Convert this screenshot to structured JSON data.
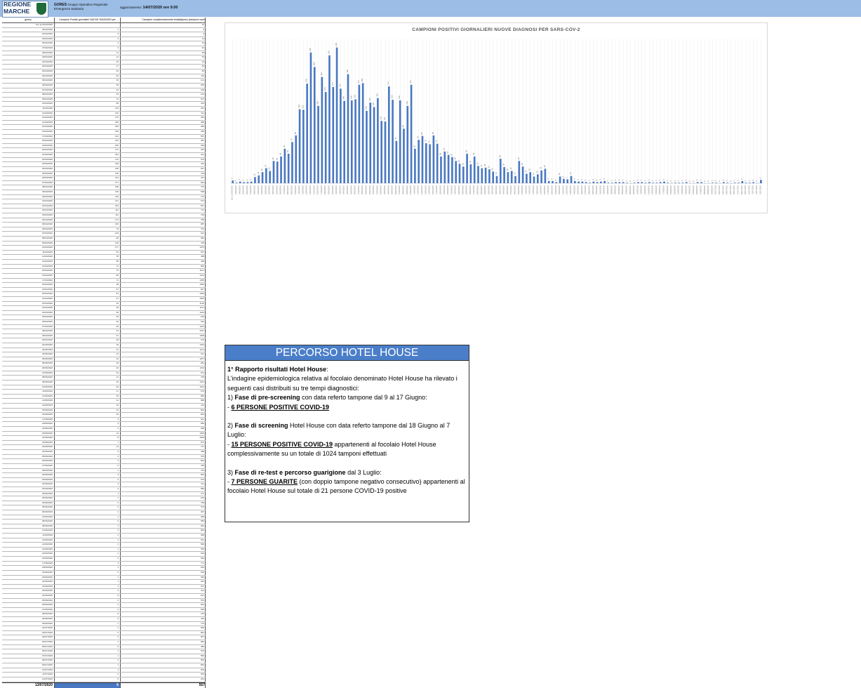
{
  "header": {
    "logo_text": [
      "REGIONE",
      "MARCHE"
    ],
    "org_name": "GORES",
    "org_line1": "Gruppo Operativo Regionale",
    "org_line2": "Emergenza Sanitaria",
    "update_prefix": "aggiornamento:",
    "update_value": "14/07/2020 ore 9.00"
  },
  "table": {
    "columns": [
      "giorno",
      "Campioni Positivi giornalieri NUOVE DIAGNOSI per",
      "Campioni complessivamente testati/giorno (tamponi nuovi"
    ],
    "first_row": [
      "fino al 22/02/2020",
      "",
      "24"
    ],
    "rows": [
      [
        "23/02/2020",
        "1",
        "5"
      ],
      [
        "24/02/2020",
        "3",
        "6"
      ],
      [
        "25/02/2020",
        "2",
        "24"
      ],
      [
        "26/02/2020",
        "2",
        "23"
      ],
      [
        "27/02/2020",
        "3",
        "32"
      ],
      [
        "28/02/2020",
        "11",
        "38"
      ],
      [
        "29/02/2020",
        "14",
        "36"
      ],
      [
        "01/03/2020",
        "20",
        "44"
      ],
      [
        "02/03/2020",
        "27",
        "83"
      ],
      [
        "03/03/2020",
        "22",
        "85"
      ],
      [
        "04/03/2020",
        "40",
        "115"
      ],
      [
        "05/03/2020",
        "39",
        "121"
      ],
      [
        "06/03/2020",
        "48",
        "205"
      ],
      [
        "07/03/2020",
        "62",
        "218"
      ],
      [
        "08/03/2020",
        "53",
        "214"
      ],
      [
        "09/03/2020",
        "74",
        "207"
      ],
      [
        "10/03/2020",
        "86",
        "316"
      ],
      [
        "11/03/2020",
        "133",
        "251"
      ],
      [
        "12/03/2020",
        "132",
        "311"
      ],
      [
        "13/03/2020",
        "179",
        "362"
      ],
      [
        "14/03/2020",
        "235",
        "380"
      ],
      [
        "15/03/2020",
        "209",
        "360"
      ],
      [
        "16/03/2020",
        "139",
        "335"
      ],
      [
        "17/03/2020",
        "191",
        "557"
      ],
      [
        "18/03/2020",
        "164",
        "451"
      ],
      [
        "19/03/2020",
        "230",
        "493"
      ],
      [
        "20/03/2020",
        "173",
        "515"
      ],
      [
        "21/03/2020",
        "244",
        "611"
      ],
      [
        "22/03/2020",
        "170",
        "575"
      ],
      [
        "23/03/2020",
        "148",
        "443"
      ],
      [
        "24/03/2020",
        "196",
        "647"
      ],
      [
        "25/03/2020",
        "149",
        "733"
      ],
      [
        "26/03/2020",
        "151",
        "437"
      ],
      [
        "27/03/2020",
        "177",
        "824"
      ],
      [
        "28/03/2020",
        "180",
        "767"
      ],
      [
        "29/03/2020",
        "130",
        "548"
      ],
      [
        "30/03/2020",
        "145",
        "741"
      ],
      [
        "31/03/2020",
        "137",
        "572"
      ],
      [
        "01/04/2020",
        "153",
        "847"
      ],
      [
        "02/04/2020",
        "112",
        "707"
      ],
      [
        "03/04/2020",
        "111",
        "794"
      ],
      [
        "04/04/2020",
        "174",
        "785"
      ],
      [
        "05/04/2020",
        "150",
        "887"
      ],
      [
        "06/04/2020",
        "76",
        "702"
      ],
      [
        "07/04/2020",
        "149",
        "913"
      ],
      [
        "08/04/2020",
        "98",
        "952"
      ],
      [
        "09/04/2020",
        "139",
        "795"
      ],
      [
        "10/04/2020",
        "177",
        "1070"
      ],
      [
        "11/04/2020",
        "62",
        "997"
      ],
      [
        "12/04/2020",
        "78",
        "458"
      ],
      [
        "13/04/2020",
        "85",
        "499"
      ],
      [
        "14/04/2020",
        "72",
        "862"
      ],
      [
        "15/04/2020",
        "70",
        "1107"
      ],
      [
        "16/04/2020",
        "86",
        "1214"
      ],
      [
        "17/04/2020",
        "71",
        "1365"
      ],
      [
        "18/04/2020",
        "48",
        "1090"
      ],
      [
        "19/04/2020",
        "57",
        "967"
      ],
      [
        "20/04/2020",
        "51",
        "1006"
      ],
      [
        "21/04/2020",
        "47",
        "1053"
      ],
      [
        "22/04/2020",
        "40",
        "1130"
      ],
      [
        "23/04/2020",
        "35",
        "1141"
      ],
      [
        "24/04/2020",
        "30",
        "1145"
      ],
      [
        "25/04/2020",
        "53",
        "916"
      ],
      [
        "26/04/2020",
        "34",
        "510"
      ],
      [
        "27/04/2020",
        "48",
        "1044"
      ],
      [
        "28/04/2020",
        "31",
        "1237"
      ],
      [
        "29/04/2020",
        "27",
        "1008"
      ],
      [
        "30/04/2020",
        "28",
        "976"
      ],
      [
        "01/05/2020",
        "25",
        "1016"
      ],
      [
        "02/05/2020",
        "21",
        "1121"
      ],
      [
        "03/05/2020",
        "13",
        "917"
      ],
      [
        "04/05/2020",
        "44",
        "1207"
      ],
      [
        "05/05/2020",
        "29",
        "981"
      ],
      [
        "06/05/2020",
        "20",
        "1232"
      ],
      [
        "07/05/2020",
        "22",
        "811"
      ],
      [
        "08/05/2020",
        "13",
        "735"
      ],
      [
        "09/05/2020",
        "40",
        "1337"
      ],
      [
        "10/05/2020",
        "30",
        "1012"
      ],
      [
        "11/05/2020",
        "17",
        "672"
      ],
      [
        "12/05/2020",
        "20",
        "865"
      ],
      [
        "13/05/2020",
        "12",
        "989"
      ],
      [
        "14/05/2020",
        "16",
        "743"
      ],
      [
        "15/05/2020",
        "23",
        "861"
      ],
      [
        "16/05/2020",
        "26",
        "863"
      ],
      [
        "17/05/2020",
        "4",
        "621"
      ],
      [
        "18/05/2020",
        "4",
        "680"
      ],
      [
        "19/05/2020",
        "2",
        "838"
      ],
      [
        "20/05/2020",
        "12",
        "1005"
      ],
      [
        "21/05/2020",
        "8",
        "1006"
      ],
      [
        "22/05/2020",
        "7",
        "871"
      ],
      [
        "23/05/2020",
        "13",
        "717"
      ],
      [
        "24/05/2020",
        "4",
        "398"
      ],
      [
        "25/05/2020",
        "3",
        "576"
      ],
      [
        "26/05/2020",
        "3",
        "802"
      ],
      [
        "27/05/2020",
        "2",
        "786"
      ],
      [
        "28/05/2020",
        "1",
        "702"
      ],
      [
        "29/05/2020",
        "3",
        "584"
      ],
      [
        "30/05/2020",
        "2",
        "670"
      ],
      [
        "31/05/2020",
        "3",
        "211"
      ],
      [
        "01/06/2020",
        "4",
        "586"
      ],
      [
        "02/06/2020",
        "1",
        "371"
      ],
      [
        "03/06/2020",
        "1",
        "623"
      ],
      [
        "04/06/2020",
        "2",
        "768"
      ],
      [
        "05/06/2020",
        "2",
        "579"
      ],
      [
        "06/06/2020",
        "2",
        "397"
      ],
      [
        "07/06/2020",
        "1",
        "360"
      ],
      [
        "08/06/2020",
        "0",
        "589"
      ],
      [
        "09/06/2020",
        "1",
        "902"
      ],
      [
        "10/06/2020",
        "2",
        "894"
      ],
      [
        "11/06/2020",
        "2",
        "638"
      ],
      [
        "12/06/2020",
        "1",
        "561"
      ],
      [
        "13/06/2020",
        "2",
        "582"
      ],
      [
        "14/06/2020",
        "1",
        "356"
      ],
      [
        "15/06/2020",
        "1",
        "640"
      ],
      [
        "16/06/2020",
        "2",
        "693"
      ],
      [
        "17/06/2020",
        "3",
        "771"
      ],
      [
        "18/06/2020",
        "1",
        "624"
      ],
      [
        "19/06/2020",
        "0",
        "549"
      ],
      [
        "20/06/2020",
        "1",
        "666"
      ],
      [
        "21/06/2020",
        "1",
        "324"
      ],
      [
        "22/06/2020",
        "1",
        "517"
      ],
      [
        "23/06/2020",
        "2",
        "611"
      ],
      [
        "24/06/2020",
        "0",
        "547"
      ],
      [
        "25/06/2020",
        "0",
        "574"
      ],
      [
        "26/06/2020",
        "2",
        "623"
      ],
      [
        "27/06/2020",
        "2",
        "696"
      ],
      [
        "28/06/2020",
        "0",
        "276"
      ],
      [
        "29/06/2020",
        "0",
        "424"
      ],
      [
        "30/06/2020",
        "1",
        "776"
      ],
      [
        "01/07/2020",
        "1",
        "846"
      ],
      [
        "02/07/2020",
        "0",
        "881"
      ],
      [
        "03/07/2020",
        "2",
        "857"
      ],
      [
        "04/07/2020",
        "1",
        "862"
      ],
      [
        "05/07/2020",
        "0",
        "385"
      ],
      [
        "06/07/2020",
        "1",
        "544"
      ],
      [
        "07/07/2020",
        "1",
        "596"
      ],
      [
        "08/07/2020",
        "4",
        "800"
      ],
      [
        "09/07/2020",
        "1",
        "854"
      ],
      [
        "10/07/2020",
        "1",
        "605"
      ],
      [
        "11/07/2020",
        "2",
        "630"
      ],
      [
        "12/07/2020",
        "0",
        "202"
      ]
    ],
    "total": [
      "13/07/2020",
      "6",
      "557"
    ]
  },
  "chart_data": {
    "type": "bar",
    "title": "CAMPIONI POSITIVI GIORNALIERI NUOVE DIAGNOSI PER SARS-COV-2",
    "categories": [
      "fino al 22/02/2020",
      "23/02/2020",
      "24/02/2020",
      "25/02/2020",
      "26/02/2020",
      "27/02/2020",
      "28/02/2020",
      "29/02/2020",
      "01/03/2020",
      "02/03/2020",
      "03/03/2020",
      "04/03/2020",
      "05/03/2020",
      "06/03/2020",
      "07/03/2020",
      "08/03/2020",
      "09/03/2020",
      "10/03/2020",
      "11/03/2020",
      "12/03/2020",
      "13/03/2020",
      "14/03/2020",
      "15/03/2020",
      "16/03/2020",
      "17/03/2020",
      "18/03/2020",
      "19/03/2020",
      "20/03/2020",
      "21/03/2020",
      "22/03/2020",
      "23/03/2020",
      "24/03/2020",
      "25/03/2020",
      "26/03/2020",
      "27/03/2020",
      "28/03/2020",
      "29/03/2020",
      "30/03/2020",
      "31/03/2020",
      "01/04/2020",
      "02/04/2020",
      "03/04/2020",
      "04/04/2020",
      "05/04/2020",
      "06/04/2020",
      "07/04/2020",
      "08/04/2020",
      "09/04/2020",
      "10/04/2020",
      "11/04/2020",
      "12/04/2020",
      "13/04/2020",
      "14/04/2020",
      "15/04/2020",
      "16/04/2020",
      "17/04/2020",
      "18/04/2020",
      "19/04/2020",
      "20/04/2020",
      "21/04/2020",
      "22/04/2020",
      "23/04/2020",
      "24/04/2020",
      "25/04/2020",
      "26/04/2020",
      "27/04/2020",
      "28/04/2020",
      "29/04/2020",
      "30/04/2020",
      "01/05/2020",
      "02/05/2020",
      "03/05/2020",
      "04/05/2020",
      "05/05/2020",
      "06/05/2020",
      "07/05/2020",
      "08/05/2020",
      "09/05/2020",
      "10/05/2020",
      "11/05/2020",
      "12/05/2020",
      "13/05/2020",
      "14/05/2020",
      "15/05/2020",
      "16/05/2020",
      "17/05/2020",
      "18/05/2020",
      "19/05/2020",
      "20/05/2020",
      "21/05/2020",
      "22/05/2020",
      "23/05/2020",
      "24/05/2020",
      "25/05/2020",
      "26/05/2020",
      "27/05/2020",
      "28/05/2020",
      "29/05/2020",
      "30/05/2020",
      "31/05/2020",
      "01/06/2020",
      "02/06/2020",
      "03/06/2020",
      "04/06/2020",
      "05/06/2020",
      "06/06/2020",
      "07/06/2020",
      "08/06/2020",
      "09/06/2020",
      "10/06/2020",
      "11/06/2020",
      "12/06/2020",
      "13/06/2020",
      "14/06/2020",
      "15/06/2020",
      "16/06/2020",
      "17/06/2020",
      "18/06/2020",
      "19/06/2020",
      "20/06/2020",
      "21/06/2020",
      "22/06/2020",
      "23/06/2020",
      "24/06/2020",
      "25/06/2020",
      "26/06/2020",
      "27/06/2020",
      "28/06/2020",
      "29/06/2020",
      "30/06/2020",
      "01/07/2020",
      "02/07/2020",
      "03/07/2020",
      "04/07/2020",
      "05/07/2020",
      "06/07/2020",
      "07/07/2020",
      "08/07/2020",
      "09/07/2020",
      "10/07/2020",
      "11/07/2020",
      "12/07/2020",
      "13/07/2020"
    ],
    "values": [
      5,
      1,
      3,
      2,
      2,
      3,
      11,
      14,
      20,
      27,
      22,
      40,
      39,
      48,
      62,
      53,
      74,
      86,
      133,
      132,
      179,
      235,
      209,
      139,
      191,
      164,
      230,
      173,
      244,
      170,
      148,
      196,
      149,
      151,
      177,
      180,
      130,
      145,
      137,
      153,
      112,
      111,
      174,
      150,
      76,
      149,
      98,
      139,
      177,
      62,
      78,
      85,
      72,
      70,
      86,
      71,
      48,
      57,
      51,
      47,
      40,
      35,
      30,
      53,
      34,
      48,
      31,
      27,
      28,
      25,
      21,
      13,
      44,
      29,
      20,
      22,
      13,
      40,
      30,
      17,
      20,
      12,
      16,
      23,
      26,
      4,
      4,
      2,
      12,
      8,
      7,
      13,
      4,
      3,
      3,
      2,
      1,
      3,
      2,
      3,
      4,
      1,
      1,
      2,
      2,
      2,
      1,
      0,
      1,
      2,
      2,
      1,
      2,
      1,
      1,
      2,
      3,
      1,
      0,
      1,
      1,
      1,
      2,
      0,
      0,
      2,
      2,
      0,
      0,
      1,
      1,
      0,
      2,
      1,
      0,
      1,
      1,
      4,
      1,
      1,
      2,
      0,
      6
    ],
    "ylim": [
      0,
      260
    ],
    "color": "#4a78c2",
    "grid": true
  },
  "hotel_box": {
    "title": "PERCORSO HOTEL HOUSE",
    "heading": "1° Rapporto  risultati Hotel House",
    "heading_suffix": ":",
    "intro": "L’indagine epidemiologica relativa al focolaio denominato Hotel House ha rilevato i seguenti casi distribuiti su tre tempi diagnostici:",
    "p1_lead": "1) ",
    "p1_bold": "Fase di pre-screening",
    "p1_rest": " con data referto tampone dal 9 al 17 Giugno:",
    "p1_dash": "- ",
    "p1_result": "6 PERSONE POSITIVE COVID-19",
    "p2_lead": "2) ",
    "p2_bold": "Fase di screening",
    "p2_rest": " Hotel House con data referto tampone dal 18 Giugno al 7 Luglio:",
    "p2_dash": "- ",
    "p2_result": "15 PERSONE POSITIVE COVID-19",
    "p2_after": " appartenenti al focolaio Hotel House complessivamente su un totale di 1024 tamponi effettuati",
    "p3_lead": "3) ",
    "p3_bold": "Fase di re-test e percorso guarigione",
    "p3_rest": " dal 3 Luglio:",
    "p3_dash": "- ",
    "p3_result": "7 PERSONE GUARITE",
    "p3_after": " (con doppio tampone negativo consecutivo) appartenenti al focolaio Hotel House sul totale di 21 persone COVID-19 positive"
  }
}
